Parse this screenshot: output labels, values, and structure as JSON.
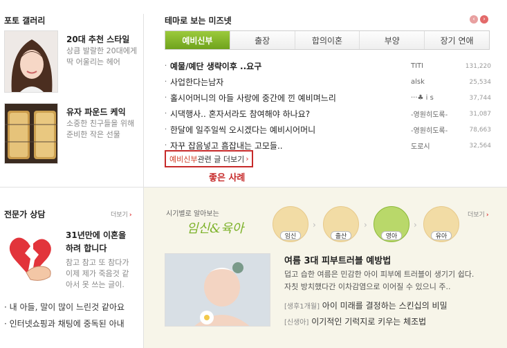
{
  "photo_gallery": {
    "title": "포토 갤러리",
    "items": [
      {
        "title": "20대 추천 스타일",
        "desc1": "상큼 발랄한 20대에게",
        "desc2": "딱 어울리는 헤어"
      },
      {
        "title": "유자 파운드 케익",
        "desc1": "소중한 친구들을 위해",
        "desc2": "준비한 작은 선물"
      }
    ]
  },
  "theme": {
    "title": "테마로 보는 미즈넷",
    "tabs": [
      {
        "label": "예비신부"
      },
      {
        "label": "출장"
      },
      {
        "label": "합의이혼"
      },
      {
        "label": "부양"
      },
      {
        "label": "장기 연애"
      }
    ],
    "posts": [
      {
        "title": "예물/예단 생략이후 ..요구",
        "author": "TITI",
        "views": "131,220"
      },
      {
        "title": "사업한다는남자",
        "author": "alsk",
        "views": "25,534"
      },
      {
        "title": "홀시어머니의 아들 사랑에 중간에 낀 예비며느리",
        "author": "···♣ i s",
        "views": "37,744"
      },
      {
        "title": "시댁행사.. 혼자서라도 참여해야 하나요?",
        "author": "-영원히도록-",
        "views": "31,087"
      },
      {
        "title": "한달에 일주일씩 오시겠다는 예비시어머니",
        "author": "-영원히도록-",
        "views": "78,663"
      },
      {
        "title": "자꾸 잡음넣고 흠잡내는 고모들..",
        "author": "도로시",
        "views": "32,564"
      }
    ],
    "more_prefix": "예비신부",
    "more_suffix": " 관련 글 더보기",
    "caption": "좋은 사례"
  },
  "expert": {
    "title": "전문가 상담",
    "more": "더보기",
    "feature_title1": "31년만에 이혼을",
    "feature_title2": "하려 합니다",
    "feature_desc1": "참고 참고 또 참다가",
    "feature_desc2": "이제 제가 죽음것 같",
    "feature_desc3": "아서 못 쓰는 글이.",
    "links": [
      {
        "text": "내 아들, 말이 많이 느린것 같아요"
      },
      {
        "text": "인터넷쇼핑과 채팅에 중독된 아내"
      }
    ]
  },
  "pregnancy": {
    "label_small": "시기별로 알아보는",
    "label_big": "임신&육아",
    "more": "더보기",
    "stages": [
      {
        "label": "임신"
      },
      {
        "label": "출산"
      },
      {
        "label": "영아"
      },
      {
        "label": "유아"
      }
    ],
    "article_title": "여름 3대 피부트러블 예방법",
    "article_desc1": "덥고 습한 여름은 민감한 아이 피부에 트러블이 생기기 쉽다.",
    "article_desc2": "자칫 방치했다간 이차감염으로 이어질 수 있으니 주..",
    "links": [
      {
        "tag": "[생후1개월]",
        "text": " 아이 미래를 결정하는 스킨십의 비밀"
      },
      {
        "tag": "[신생아]",
        "text": " 이기적인 기럭지로 키우는 체조법"
      }
    ]
  },
  "colors": {
    "accent_green": "#7db22a",
    "highlight_red": "#c62a2a"
  }
}
